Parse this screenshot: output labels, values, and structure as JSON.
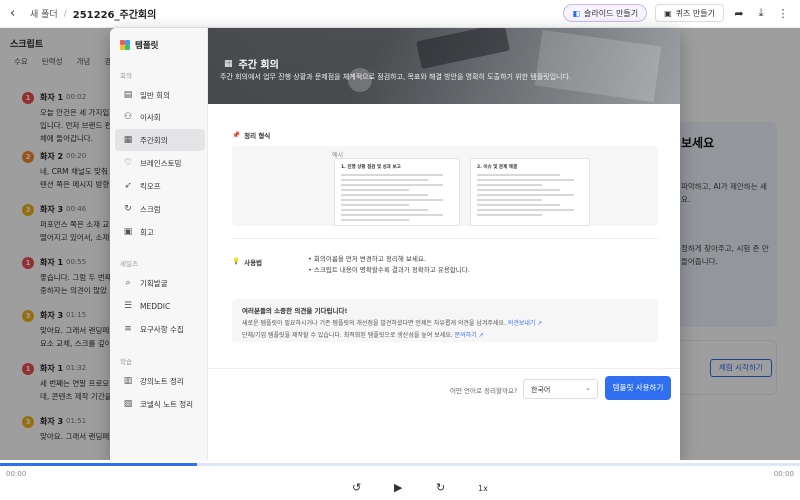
{
  "topbar": {
    "breadcrumb_folder": "새 폴더",
    "breadcrumb_current": "251226_주간회의",
    "slides_button": "슬라이드 만들기",
    "quiz_button": "퀴즈 만들기"
  },
  "script": {
    "heading": "스크립트",
    "tabs": [
      "수요",
      "탄력성",
      "개념",
      "경치"
    ]
  },
  "transcript": [
    {
      "speaker": "화자 1",
      "badge": "1",
      "color": "#ea4f4f",
      "time": "00:02",
      "text": "오늘 안건은 세 가지입",
      "text2": "입니다. 먼저 브랜드 편",
      "text3": "체에 들어갑니다."
    },
    {
      "speaker": "화자 2",
      "badge": "2",
      "color": "#f08a2a",
      "time": "00:20",
      "text": "네, CRM 채널도 맞춰",
      "text2": "텐션 쪽은 메시지 방향",
      "text3": ""
    },
    {
      "speaker": "화자 3",
      "badge": "3",
      "color": "#f0b21a",
      "time": "00:46",
      "text": "퍼포먼스 쪽은 소재 교",
      "text2": "떨어지고 있어서, 소재",
      "text3": ""
    },
    {
      "speaker": "화자 1",
      "badge": "1",
      "color": "#ea4f4f",
      "time": "00:55",
      "text": "좋습니다. 그럼 두 번째",
      "text2": "중하자는 의견이 많았",
      "text3": ""
    },
    {
      "speaker": "화자 3",
      "badge": "3",
      "color": "#f0b21a",
      "time": "01:15",
      "text": "맞아요. 그래서 랜딩페",
      "text2": "요소 교체, 스크롤 깊이",
      "text3": ""
    },
    {
      "speaker": "화자 1",
      "badge": "1",
      "color": "#ea4f4f",
      "time": "01:32",
      "text": "세 번째는 연말 프로모",
      "text2": "데, 콘텐츠 제작 기간을 조금 앞당겨야 할 것 같아요.",
      "text3": ""
    },
    {
      "speaker": "화자 3",
      "badge": "3",
      "color": "#f0b21a",
      "time": "01:51",
      "text": "맞아요. 그래서 랜딩페이지 AB 테스트를 우선으로 잡는 게 맞을 것 같아요. CTA 문구 변경, 첫 화면 시각",
      "text2": "",
      "text3": ""
    }
  ],
  "right_panel": {
    "title": "보세요",
    "text1": "파악하고, AI가 제안하는 세요.",
    "text2": "정하게 찾아주고, 시험 준 만들어줍니다.",
    "trial_button": "체험 시작하기"
  },
  "modal": {
    "logo": "템플릿",
    "sections": [
      {
        "label": "회의",
        "items": [
          "일반 회의",
          "이사회",
          "주간회의",
          "브레인스토밍",
          "킥오프",
          "스크럼",
          "회고"
        ]
      },
      {
        "label": "세일즈",
        "items": [
          "기획발굴",
          "MEDDIC",
          "요구사항 수집"
        ]
      },
      {
        "label": "학습",
        "items": [
          "강의노트 정리",
          "코넬식 노트 정리"
        ]
      }
    ],
    "active_item": "주간회의",
    "hero_title": "주간 회의",
    "hero_desc": "주간 회의에서 업무 진행 상황과 문제점을 체계적으로 점검하고, 목표와 해결 방안을 명확히 도출하기 위한 템플릿입니다.",
    "format_title": "정리 형식",
    "example_label": "예시",
    "doc1_heading": "1. 진행 상황 점검 및 성과 보고",
    "doc2_heading": "2. 이슈 및 문제 해결",
    "usage_label": "사용법",
    "usage_lines": [
      "• 회의이름을 먼저 변경하고 정리해 보세요.",
      "• 스크립트 내용이 명확할수록 결과가 정확하고 유용합니다."
    ],
    "feedback_title": "여러분들의 소중한 의견을 기다립니다!",
    "feedback_line1": "새로운 템플릿이 필요하시거나 기존 템플릿의 개선점을 발견하셨다면 언제든 자유롭게 의견을 남겨주세요.",
    "feedback_link1": "의견보내기 ↗",
    "feedback_line2": "단체/기업 템플릿을 제작할 수 있습니다. 최적화된 템플릿으로 생산성을 높여 보세요.",
    "feedback_link2": "문의하기 ↗",
    "lang_question": "어떤 언어로 정리할까요?",
    "lang_value": "한국어",
    "use_button": "템플릿 사용하기",
    "close": "×"
  },
  "player": {
    "time_left": "00:00",
    "time_right": "00:00",
    "speed": "1x",
    "progress": 0.246
  },
  "colors": {
    "accent": "#2f6ff0",
    "speaker1": "#ea4f4f",
    "speaker2": "#f08a2a",
    "speaker3": "#f0b21a"
  }
}
